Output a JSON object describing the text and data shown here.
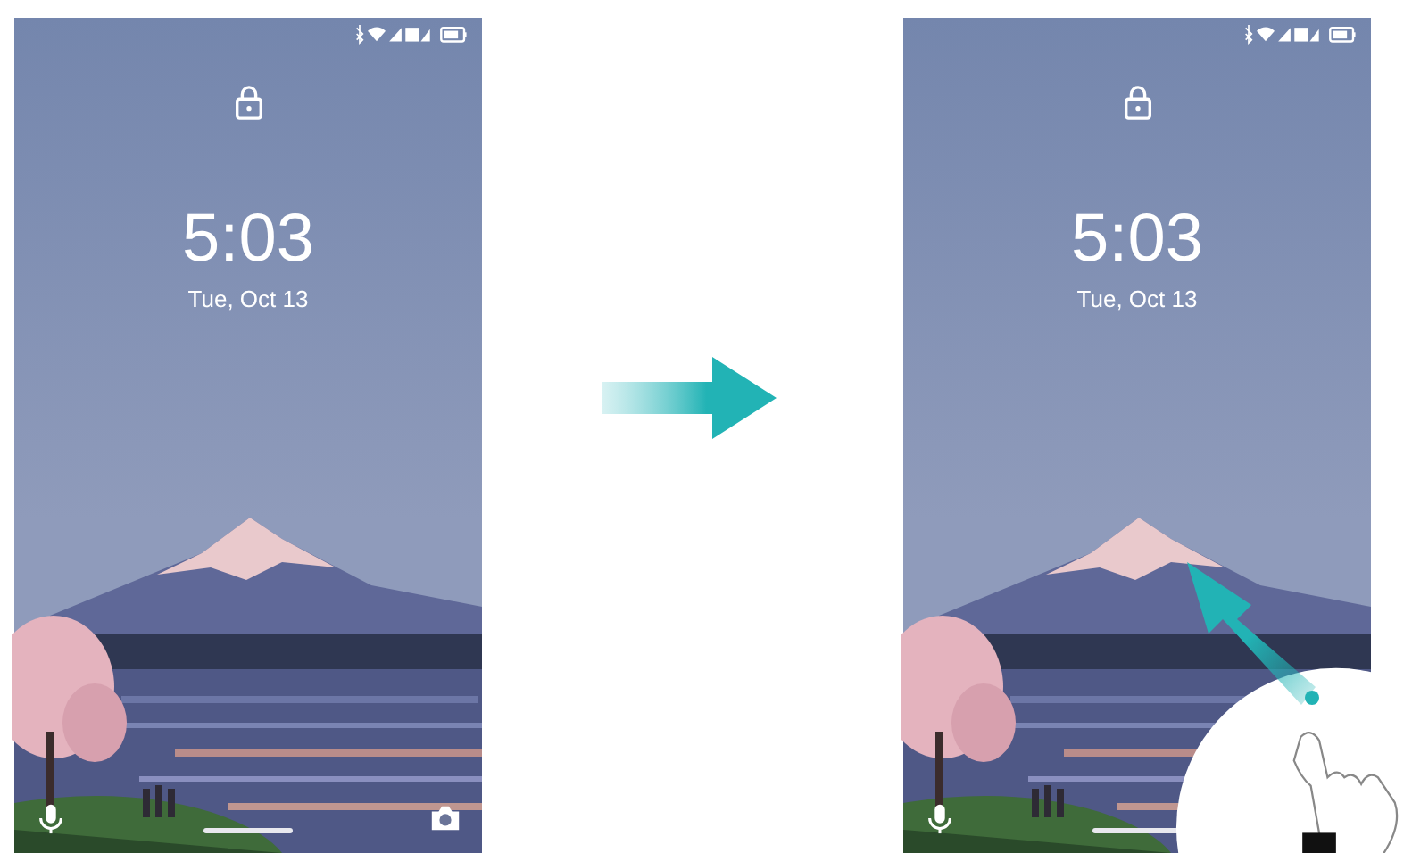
{
  "screens": [
    {
      "time": "5:03",
      "date": "Tue, Oct 13",
      "swipe_gesture": false
    },
    {
      "time": "5:03",
      "date": "Tue, Oct 13",
      "swipe_gesture": true
    }
  ]
}
